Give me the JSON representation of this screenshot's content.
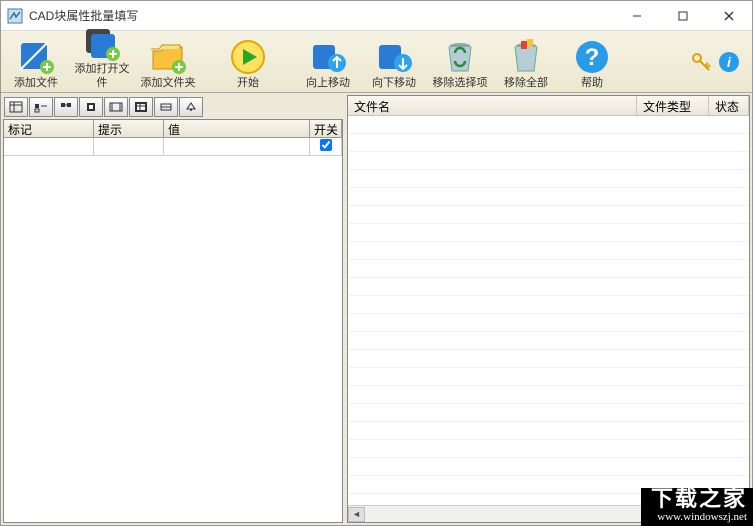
{
  "titlebar": {
    "title": "CAD块属性批量填写"
  },
  "toolbar": {
    "add_file": "添加文件",
    "add_open_file": "添加打开文件",
    "add_folder": "添加文件夹",
    "start": "开始",
    "move_up": "向上移动",
    "move_down": "向下移动",
    "remove_selected": "移除选择项",
    "remove_all": "移除全部",
    "help": "帮助"
  },
  "left_grid": {
    "columns": {
      "mark": "标记",
      "hint": "提示",
      "value": "值",
      "switch": "开关"
    },
    "rows": [
      {
        "mark": "",
        "hint": "",
        "value": "",
        "switch": true
      }
    ]
  },
  "right_list": {
    "columns": {
      "filename": "文件名",
      "filetype": "文件类型",
      "status": "状态"
    }
  },
  "watermark": {
    "name": "下载之家",
    "url": "www.windowszj.net"
  }
}
